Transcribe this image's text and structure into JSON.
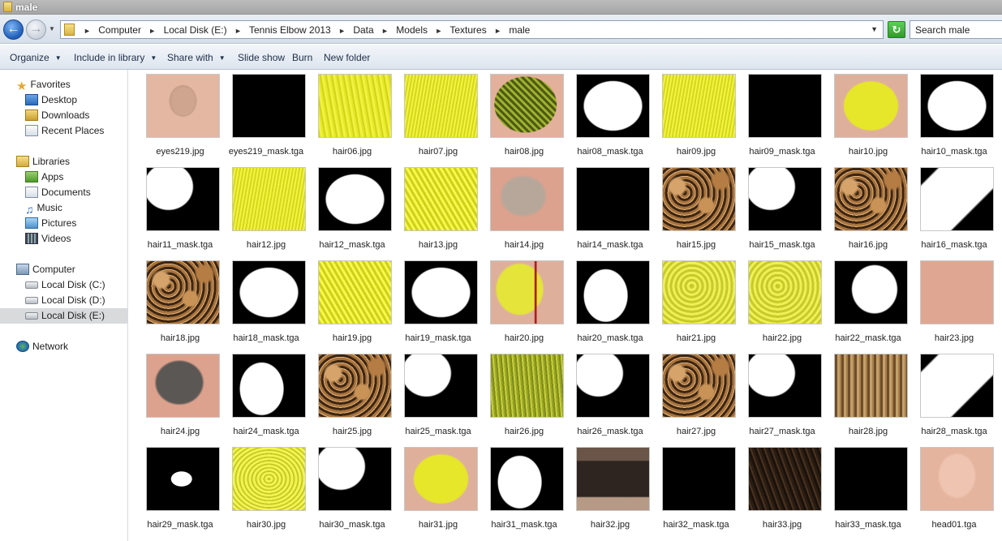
{
  "window": {
    "title": "male"
  },
  "address": {
    "crumbs": [
      "Computer",
      "Local Disk (E:)",
      "Tennis Elbow 2013",
      "Data",
      "Models",
      "Textures",
      "male"
    ],
    "search_placeholder": "Search male"
  },
  "toolbar": {
    "organize": "Organize",
    "include_in_library": "Include in library",
    "share_with": "Share with",
    "slide_show": "Slide show",
    "burn": "Burn",
    "new_folder": "New folder"
  },
  "nav": {
    "favorites": "Favorites",
    "desktop": "Desktop",
    "downloads": "Downloads",
    "recent_places": "Recent Places",
    "libraries": "Libraries",
    "apps": "Apps",
    "documents": "Documents",
    "music": "Music",
    "pictures": "Pictures",
    "videos": "Videos",
    "computer": "Computer",
    "disk_c": "Local Disk (C:)",
    "disk_d": "Local Disk (D:)",
    "disk_e": "Local Disk (E:)",
    "network": "Network"
  },
  "files": [
    {
      "name": "eyes219.jpg",
      "thumb": "t-face"
    },
    {
      "name": "eyes219_mask.tga",
      "thumb": "t-black"
    },
    {
      "name": "hair06.jpg",
      "thumb": "t-yellow"
    },
    {
      "name": "hair07.jpg",
      "thumb": "t-yellow2"
    },
    {
      "name": "hair08.jpg",
      "thumb": "t-braid-skin"
    },
    {
      "name": "hair08_mask.tga",
      "thumb": "t-mask-blob"
    },
    {
      "name": "hair09.jpg",
      "thumb": "t-yellow2"
    },
    {
      "name": "hair09_mask.tga",
      "thumb": "t-black"
    },
    {
      "name": "hair10.jpg",
      "thumb": "t-yellow-skin"
    },
    {
      "name": "hair10_mask.tga",
      "thumb": "t-mask-blob"
    },
    {
      "name": "hair11_mask.tga",
      "thumb": "t-mask-wing"
    },
    {
      "name": "hair12.jpg",
      "thumb": "t-yellow2"
    },
    {
      "name": "hair12_mask.tga",
      "thumb": "t-mask-blob"
    },
    {
      "name": "hair13.jpg",
      "thumb": "t-yellow3"
    },
    {
      "name": "hair14.jpg",
      "thumb": "t-skin-gray"
    },
    {
      "name": "hair14_mask.tga",
      "thumb": "t-black"
    },
    {
      "name": "hair15.jpg",
      "thumb": "t-curl"
    },
    {
      "name": "hair15_mask.tga",
      "thumb": "t-mask-wing"
    },
    {
      "name": "hair16.jpg",
      "thumb": "t-curl"
    },
    {
      "name": "hair16_mask.tga",
      "thumb": "t-mask-wing2"
    },
    {
      "name": "hair18.jpg",
      "thumb": "t-curl"
    },
    {
      "name": "hair18_mask.tga",
      "thumb": "t-mask-blob"
    },
    {
      "name": "hair19.jpg",
      "thumb": "t-yellow3"
    },
    {
      "name": "hair19_mask.tga",
      "thumb": "t-mask-blob"
    },
    {
      "name": "hair20.jpg",
      "thumb": "t-yellow-hair20"
    },
    {
      "name": "hair20_mask.tga",
      "thumb": "t-mask-head"
    },
    {
      "name": "hair21.jpg",
      "thumb": "t-yellow-wave"
    },
    {
      "name": "hair22.jpg",
      "thumb": "t-yellow-wave"
    },
    {
      "name": "hair22_mask.tga",
      "thumb": "t-mask-long"
    },
    {
      "name": "hair23.jpg",
      "thumb": "t-skin"
    },
    {
      "name": "hair24.jpg",
      "thumb": "t-skin-dark"
    },
    {
      "name": "hair24_mask.tga",
      "thumb": "t-mask-head"
    },
    {
      "name": "hair25.jpg",
      "thumb": "t-curl"
    },
    {
      "name": "hair25_mask.tga",
      "thumb": "t-mask-wing"
    },
    {
      "name": "hair26.jpg",
      "thumb": "t-yellowgreen"
    },
    {
      "name": "hair26_mask.tga",
      "thumb": "t-mask-wing"
    },
    {
      "name": "hair27.jpg",
      "thumb": "t-curl"
    },
    {
      "name": "hair27_mask.tga",
      "thumb": "t-mask-wing"
    },
    {
      "name": "hair28.jpg",
      "thumb": "t-dread"
    },
    {
      "name": "hair28_mask.tga",
      "thumb": "t-mask-wing2"
    },
    {
      "name": "hair29_mask.tga",
      "thumb": "t-mask-small"
    },
    {
      "name": "hair30.jpg",
      "thumb": "t-yellow-curl"
    },
    {
      "name": "hair30_mask.tga",
      "thumb": "t-mask-wing"
    },
    {
      "name": "hair31.jpg",
      "thumb": "t-yellow-skin"
    },
    {
      "name": "hair31_mask.tga",
      "thumb": "t-mask-head"
    },
    {
      "name": "hair32.jpg",
      "thumb": "t-skin-strip"
    },
    {
      "name": "hair32_mask.tga",
      "thumb": "t-black"
    },
    {
      "name": "hair33.jpg",
      "thumb": "t-darkhair"
    },
    {
      "name": "hair33_mask.tga",
      "thumb": "t-black"
    },
    {
      "name": "head01.tga",
      "thumb": "t-head"
    }
  ]
}
